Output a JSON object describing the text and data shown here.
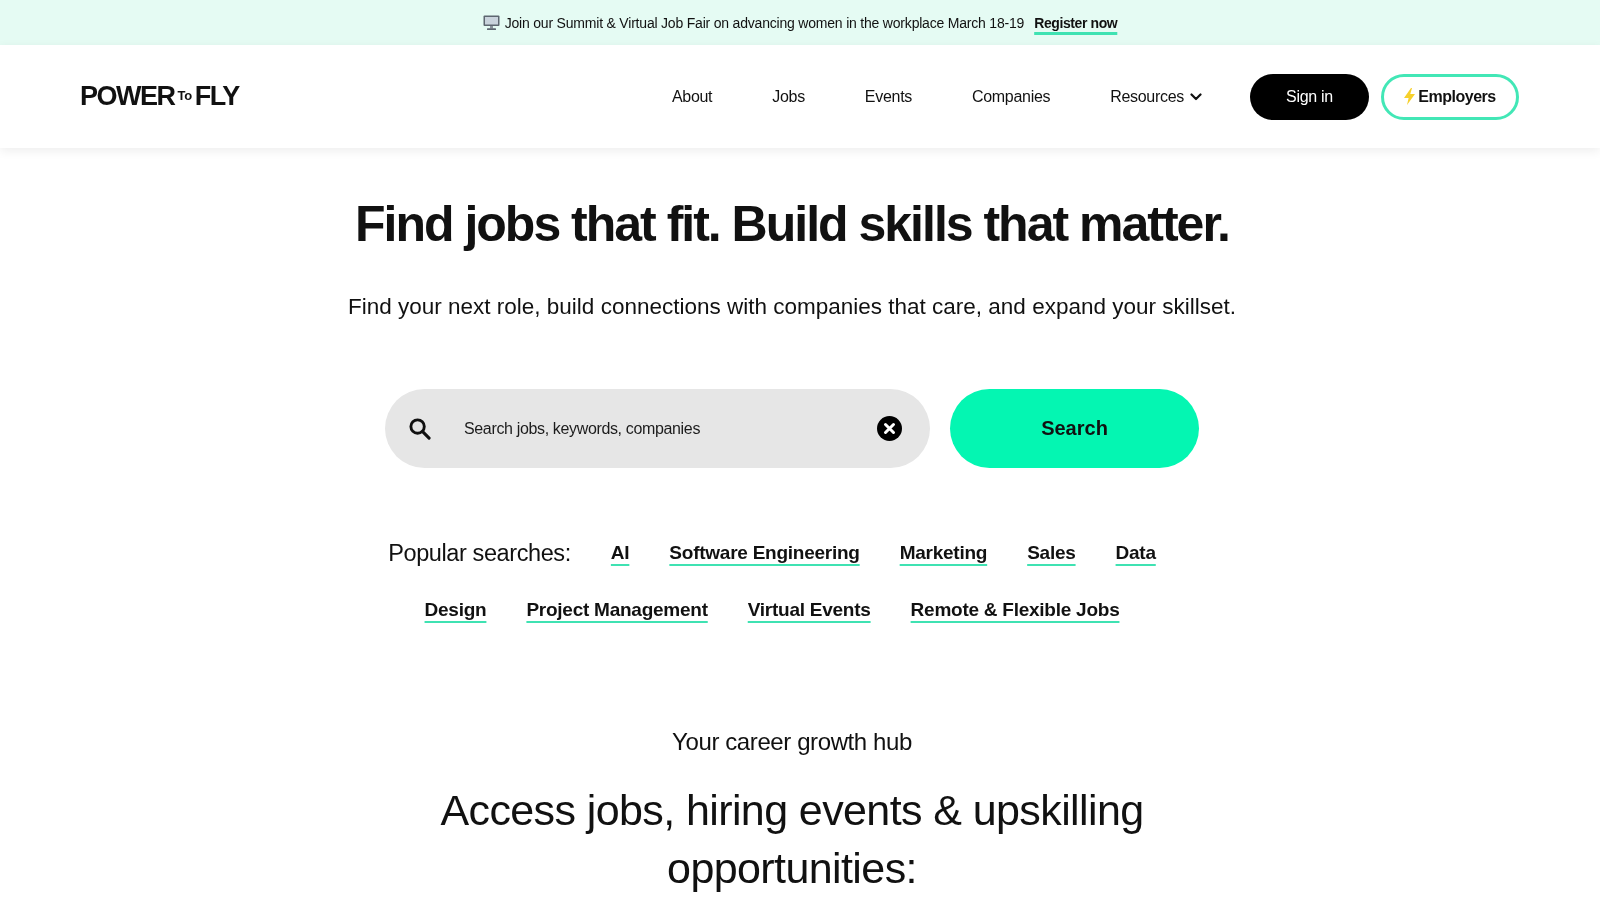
{
  "announcement_bar": {
    "text": "Join our Summit & Virtual Job Fair on advancing women in the workplace March 18-19",
    "link": "Register now"
  },
  "header": {
    "logo": [
      {
        "kind": "word",
        "text": "POWER"
      },
      {
        "kind": "small",
        "text": "To"
      },
      {
        "kind": "word",
        "text": "FLY"
      }
    ],
    "nav": [
      {
        "kind": "link",
        "label": "About"
      },
      {
        "kind": "link",
        "label": "Jobs"
      },
      {
        "kind": "link",
        "label": "Events"
      },
      {
        "kind": "link",
        "label": "Companies"
      },
      {
        "kind": "dropdown",
        "label": "Resources"
      }
    ],
    "buttons": [
      {
        "kind": "solid",
        "label": "Sign in"
      },
      {
        "kind": "outline",
        "label": "Employers"
      }
    ]
  },
  "hero": {
    "title": "Find jobs that fit. Build skills that matter.",
    "subtitle": "Find your next role, build connections with companies that care, and expand your skillset.",
    "search": {
      "placeholder": "Search jobs, keywords, companies",
      "button": "Search"
    },
    "popular_searches": {
      "label": "Popular searches:",
      "items": [
        "AI",
        "Software Engineering",
        "Marketing",
        "Sales",
        "Data",
        "Design",
        "Project Management",
        "Virtual Events",
        "Remote & Flexible Jobs"
      ]
    }
  },
  "career_hub": {
    "eyebrow": "Your career growth hub",
    "heading": "Access jobs, hiring events & upskilling opportunities:"
  }
}
